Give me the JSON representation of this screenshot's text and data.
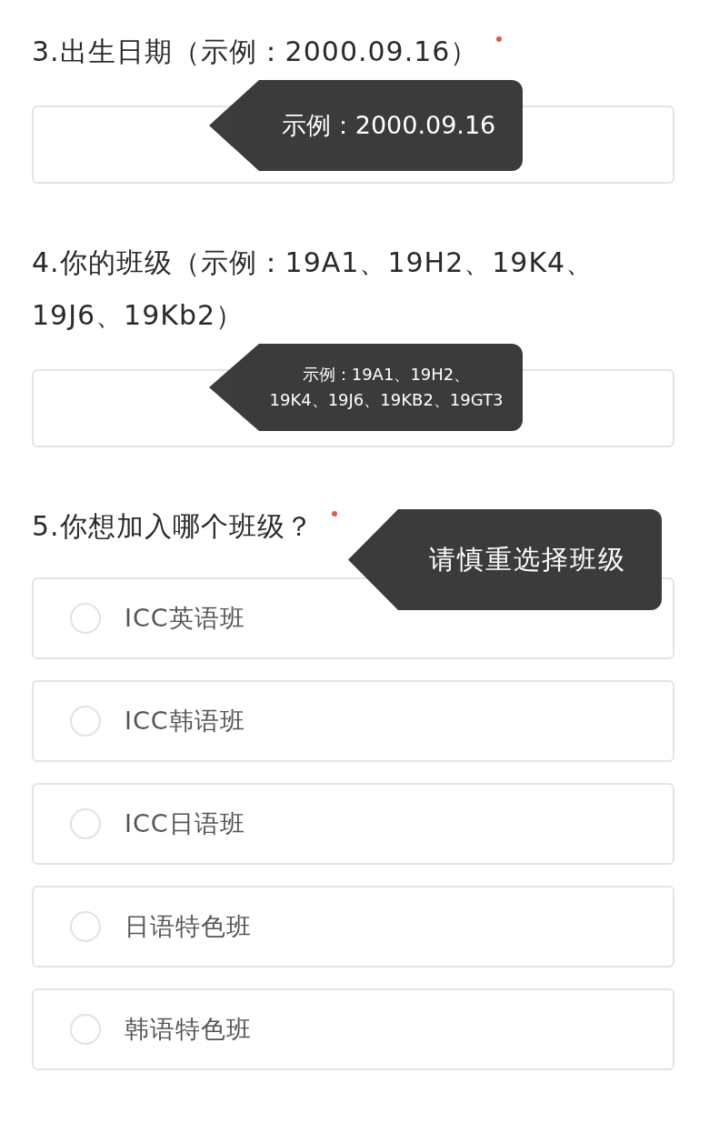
{
  "questions": [
    {
      "kind": "text",
      "label": "3.出生日期（示例：2000.09.16）",
      "required": true,
      "tooltip": [
        "示例：2000.09.16"
      ]
    },
    {
      "kind": "text",
      "label": "4.你的班级（示例：19A1、19H2、19K4、19J6、19Kb2）",
      "tooltip": [
        "示例：19A1、19H2、",
        "19K4、19J6、19KB2、19GT3"
      ]
    },
    {
      "kind": "radio",
      "label": "5.你想加入哪个班级？",
      "required": true,
      "tooltip": [
        "请慎重选择班级"
      ],
      "options": [
        {
          "label": "ICC英语班",
          "selected": false
        },
        {
          "label": "ICC韩语班",
          "selected": false
        },
        {
          "label": "ICC日语班",
          "selected": false
        },
        {
          "label": "日语特色班",
          "selected": false
        },
        {
          "label": "韩语特色班",
          "selected": false
        }
      ]
    }
  ]
}
